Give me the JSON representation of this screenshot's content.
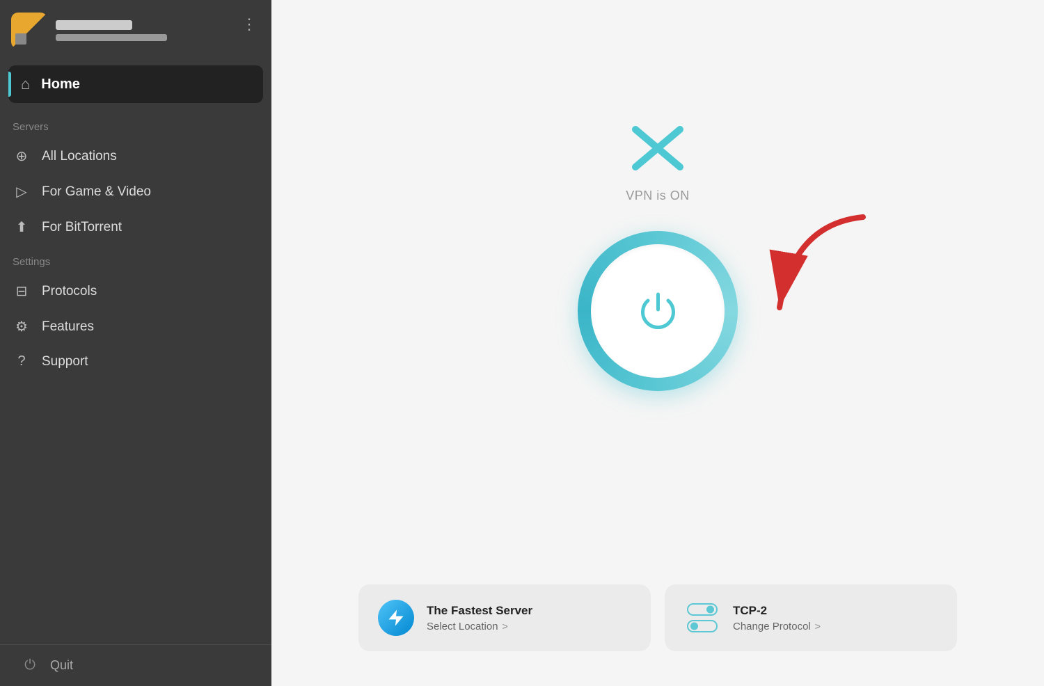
{
  "sidebar": {
    "home_label": "Home",
    "servers_section": "Servers",
    "settings_section": "Settings",
    "nav_items": [
      {
        "id": "all-locations",
        "label": "All Locations",
        "icon": "globe"
      },
      {
        "id": "game-video",
        "label": "For Game & Video",
        "icon": "play"
      },
      {
        "id": "bittorrent",
        "label": "For BitTorrent",
        "icon": "upload"
      }
    ],
    "settings_items": [
      {
        "id": "protocols",
        "label": "Protocols",
        "icon": "sliders"
      },
      {
        "id": "features",
        "label": "Features",
        "icon": "gear"
      },
      {
        "id": "support",
        "label": "Support",
        "icon": "question"
      }
    ],
    "quit_label": "Quit"
  },
  "main": {
    "vpn_status": "VPN is ON",
    "location_card": {
      "title": "The Fastest Server",
      "subtitle": "Select Location",
      "chevron": ">"
    },
    "protocol_card": {
      "title": "TCP-2",
      "subtitle": "Change Protocol",
      "chevron": ">"
    }
  }
}
